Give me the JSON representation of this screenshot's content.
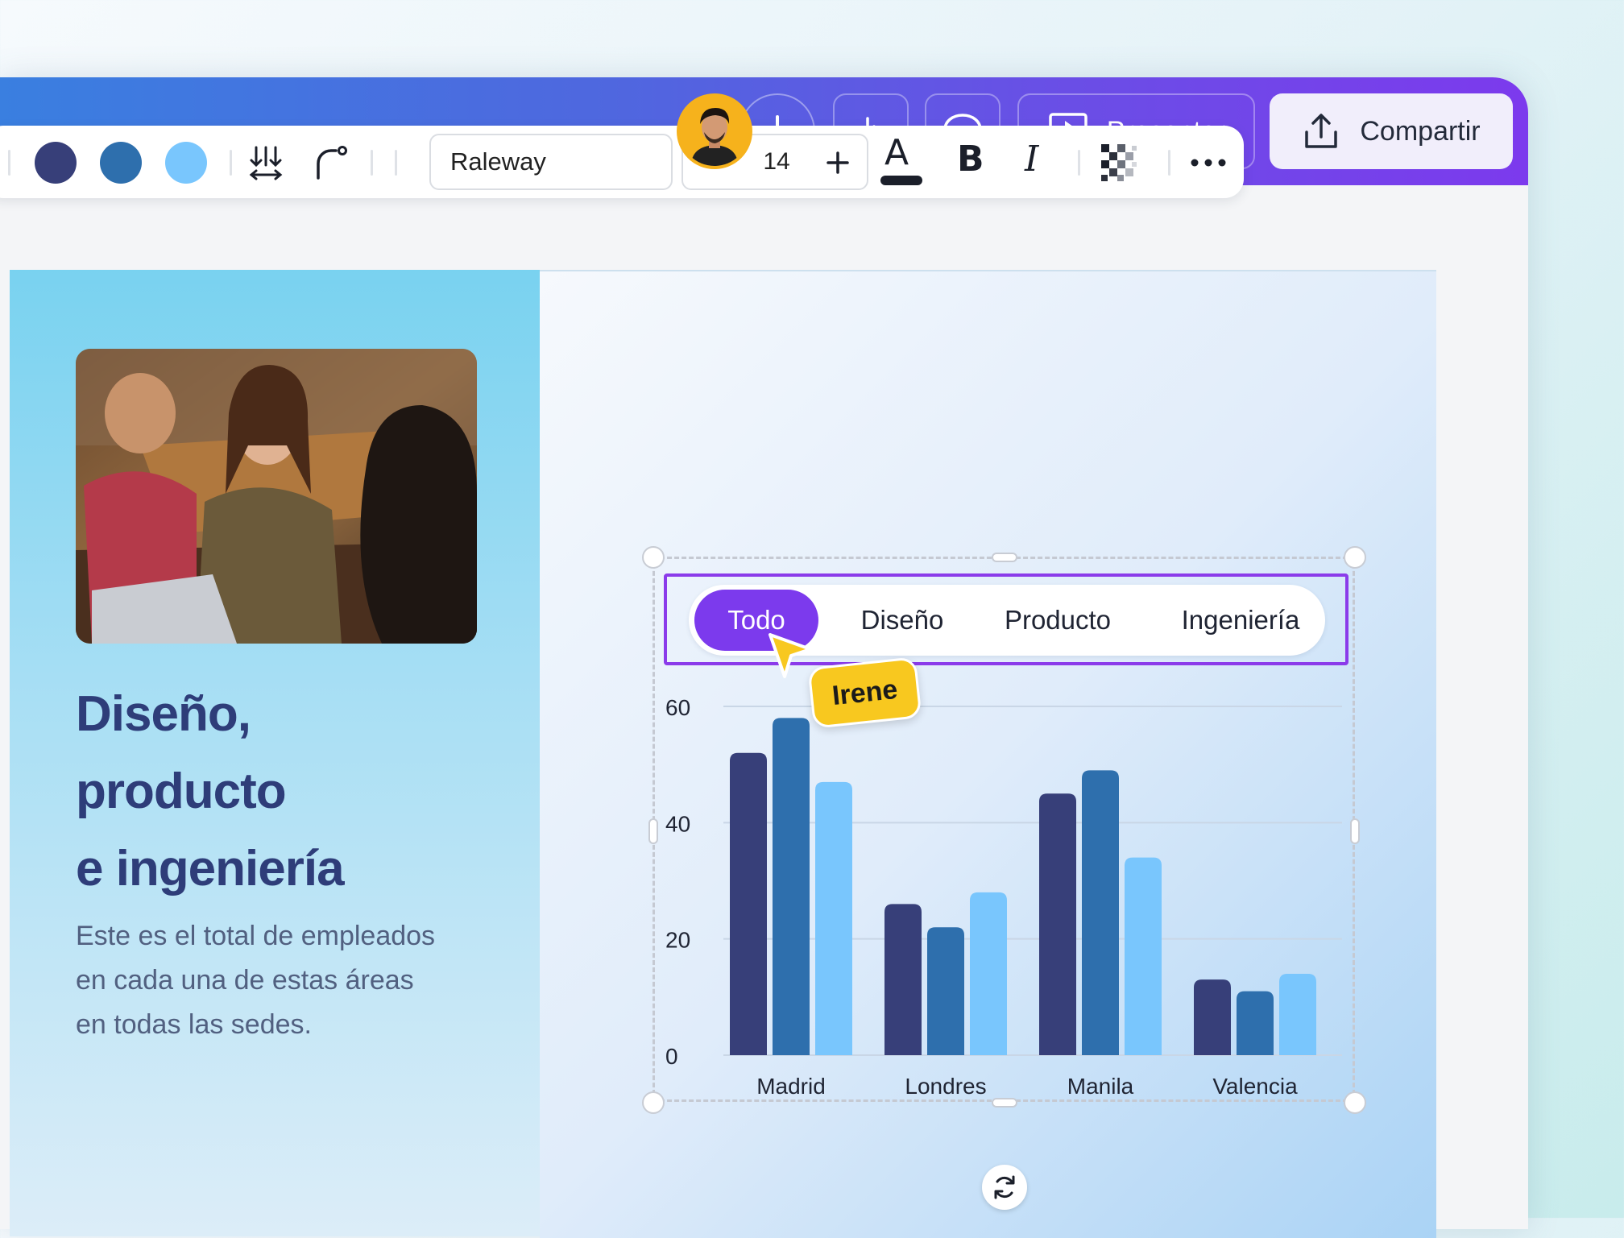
{
  "topbar": {
    "present_label": "Presentar",
    "share_label": "Compartir"
  },
  "toolbar": {
    "swatches": [
      "#373f79",
      "#2e6fad",
      "#79c6fd"
    ],
    "font_name": "Raleway",
    "font_size": "14",
    "minus": "−",
    "plus": "+",
    "text_color_glyph": "A",
    "bold_glyph": "B",
    "italic_glyph": "I"
  },
  "slide": {
    "heading": [
      "Diseño,",
      "producto",
      "e ingeniería"
    ],
    "paragraph": [
      "Este es el total de empleados",
      "en cada una de estas áreas",
      "en todas las sedes."
    ]
  },
  "filters": {
    "tabs": [
      "Todo",
      "Diseño",
      "Producto",
      "Ingeniería"
    ],
    "active": 0
  },
  "collaborator": {
    "name": "Irene"
  },
  "chart_data": {
    "type": "bar",
    "categories": [
      "Madrid",
      "Londres",
      "Manila",
      "Valencia"
    ],
    "series": [
      {
        "values": [
          52,
          26,
          45,
          13
        ],
        "color": "#373f79"
      },
      {
        "values": [
          58,
          22,
          49,
          11
        ],
        "color": "#2e6fad"
      },
      {
        "values": [
          47,
          28,
          34,
          14
        ],
        "color": "#79c6fd"
      }
    ],
    "yticks": [
      0,
      20,
      40,
      60
    ],
    "ylim": [
      0,
      60
    ],
    "grid": true,
    "legend": "none"
  }
}
